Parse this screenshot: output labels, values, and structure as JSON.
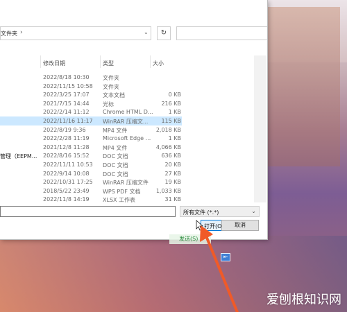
{
  "address": {
    "path": "文件夹",
    "chevron": "›"
  },
  "columns": {
    "date": "修改日期",
    "type": "类型",
    "size": "大小"
  },
  "rows": [
    {
      "name": "",
      "date": "2022/8/18 10:30",
      "type": "文件夹",
      "size": "",
      "selected": false
    },
    {
      "name": "",
      "date": "2022/11/15 10:58",
      "type": "文件夹",
      "size": "",
      "selected": false
    },
    {
      "name": "",
      "date": "2022/3/25 17:07",
      "type": "文本文档",
      "size": "0 KB",
      "selected": false
    },
    {
      "name": "",
      "date": "2021/7/15 14:44",
      "type": "光标",
      "size": "216 KB",
      "selected": false
    },
    {
      "name": "",
      "date": "2022/2/14 11:12",
      "type": "Chrome HTML D...",
      "size": "1 KB",
      "selected": false
    },
    {
      "name": "",
      "date": "2022/11/16 11:17",
      "type": "WinRAR 压缩文...",
      "size": "115 KB",
      "selected": true
    },
    {
      "name": "",
      "date": "2022/8/19 9:36",
      "type": "MP4 文件",
      "size": "2,018 KB",
      "selected": false
    },
    {
      "name": "",
      "date": "2022/2/28 11:19",
      "type": "Microsoft Edge ...",
      "size": "1 KB",
      "selected": false
    },
    {
      "name": "",
      "date": "2021/12/8 11:28",
      "type": "MP4 文件",
      "size": "4,066 KB",
      "selected": false
    },
    {
      "name": "管理（EEPM...",
      "date": "2022/8/16 15:52",
      "type": "DOC 文档",
      "size": "636 KB",
      "selected": false
    },
    {
      "name": "",
      "date": "2022/11/11 10:53",
      "type": "DOC 文档",
      "size": "20 KB",
      "selected": false
    },
    {
      "name": "",
      "date": "2022/9/14 10:08",
      "type": "DOC 文档",
      "size": "27 KB",
      "selected": false
    },
    {
      "name": "",
      "date": "2022/10/31 17:25",
      "type": "WinRAR 压缩文件",
      "size": "19 KB",
      "selected": false
    },
    {
      "name": "",
      "date": "2018/5/22 23:49",
      "type": "WPS PDF 文档",
      "size": "1,033 KB",
      "selected": false
    },
    {
      "name": "",
      "date": "2022/11/8 14:19",
      "type": "XLSX 工作表",
      "size": "31 KB",
      "selected": false
    }
  ],
  "filter": {
    "label": "所有文件 (*.*)",
    "arrow": "⌄"
  },
  "buttons": {
    "open": "打开(O)",
    "open_dropdown": "▾",
    "cancel": "取消",
    "refresh": "↻",
    "addr_dropdown": "⌄"
  },
  "overlay": {
    "green_tag": "发送(S)",
    "small_button": "⇤"
  },
  "watermark": "爱刨根知识网",
  "colors": {
    "selection": "#cce8ff",
    "accent": "#0078d7",
    "arrow": "#f05a28"
  }
}
